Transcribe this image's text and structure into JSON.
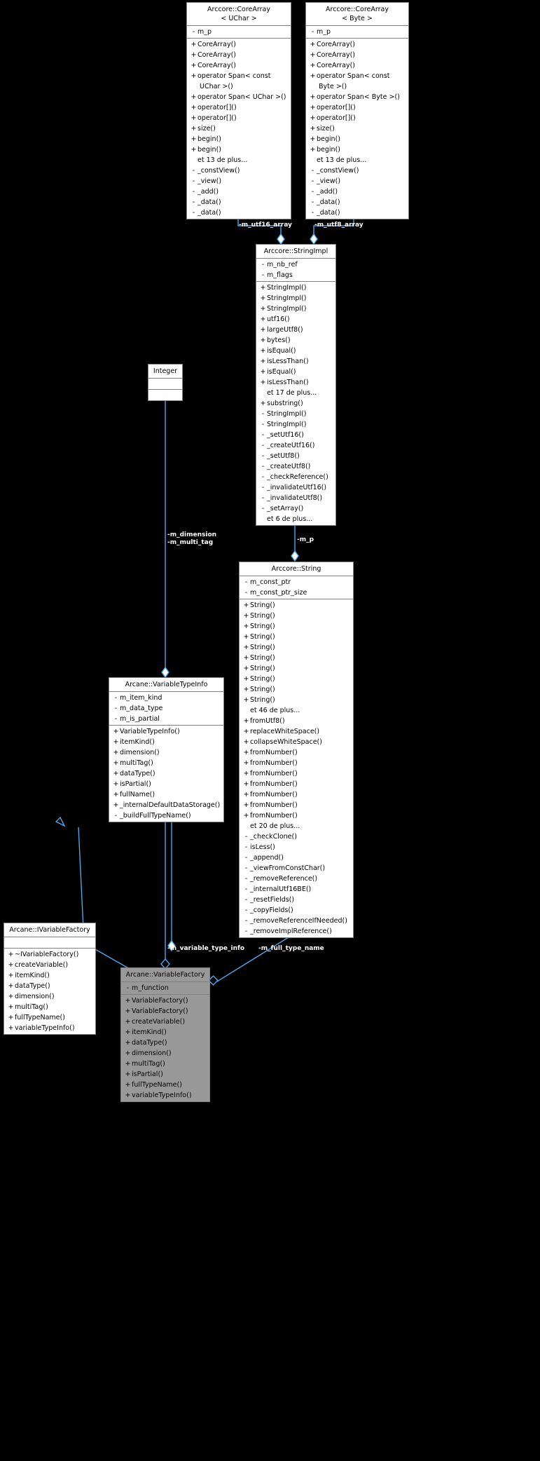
{
  "diagram": {
    "kind": "uml-class-diagram",
    "background": "#000000",
    "edge_color": "#4da6e8",
    "focus_fill": "#999999",
    "box_fill": "#ffffff",
    "more_suffix": "de plus..."
  },
  "classes": {
    "corearray_uchar": {
      "title": "Arccore::CoreArray\n< UChar >",
      "attributes": [
        {
          "vis": "-",
          "name": "m_p"
        }
      ],
      "operations": [
        {
          "vis": "+",
          "name": "CoreArray()"
        },
        {
          "vis": "+",
          "name": "CoreArray()"
        },
        {
          "vis": "+",
          "name": "CoreArray()"
        },
        {
          "vis": "+",
          "name": "operator Span< const\n UChar >()"
        },
        {
          "vis": "+",
          "name": "operator Span< UChar >()"
        },
        {
          "vis": "+",
          "name": "operator[]()"
        },
        {
          "vis": "+",
          "name": "operator[]()"
        },
        {
          "vis": "+",
          "name": "size()"
        },
        {
          "vis": "+",
          "name": "begin()"
        },
        {
          "vis": "+",
          "name": "begin()"
        },
        {
          "vis": "",
          "name": "et 13 de plus..."
        },
        {
          "vis": "-",
          "name": "_constView()"
        },
        {
          "vis": "-",
          "name": "_view()"
        },
        {
          "vis": "-",
          "name": "_add()"
        },
        {
          "vis": "-",
          "name": "_data()"
        },
        {
          "vis": "-",
          "name": "_data()"
        }
      ]
    },
    "corearray_byte": {
      "title": "Arccore::CoreArray\n< Byte >",
      "attributes": [
        {
          "vis": "-",
          "name": "m_p"
        }
      ],
      "operations": [
        {
          "vis": "+",
          "name": "CoreArray()"
        },
        {
          "vis": "+",
          "name": "CoreArray()"
        },
        {
          "vis": "+",
          "name": "CoreArray()"
        },
        {
          "vis": "+",
          "name": "operator Span< const\n Byte >()"
        },
        {
          "vis": "+",
          "name": "operator Span< Byte >()"
        },
        {
          "vis": "+",
          "name": "operator[]()"
        },
        {
          "vis": "+",
          "name": "operator[]()"
        },
        {
          "vis": "+",
          "name": "size()"
        },
        {
          "vis": "+",
          "name": "begin()"
        },
        {
          "vis": "+",
          "name": "begin()"
        },
        {
          "vis": "",
          "name": "et 13 de plus..."
        },
        {
          "vis": "-",
          "name": "_constView()"
        },
        {
          "vis": "-",
          "name": "_view()"
        },
        {
          "vis": "-",
          "name": "_add()"
        },
        {
          "vis": "-",
          "name": "_data()"
        },
        {
          "vis": "-",
          "name": "_data()"
        }
      ]
    },
    "stringimpl": {
      "title": "Arccore::StringImpl",
      "attributes": [
        {
          "vis": "-",
          "name": "m_nb_ref"
        },
        {
          "vis": "-",
          "name": "m_flags"
        }
      ],
      "operations": [
        {
          "vis": "+",
          "name": "StringImpl()"
        },
        {
          "vis": "+",
          "name": "StringImpl()"
        },
        {
          "vis": "+",
          "name": "StringImpl()"
        },
        {
          "vis": "+",
          "name": "utf16()"
        },
        {
          "vis": "+",
          "name": "largeUtf8()"
        },
        {
          "vis": "+",
          "name": "bytes()"
        },
        {
          "vis": "+",
          "name": "isEqual()"
        },
        {
          "vis": "+",
          "name": "isLessThan()"
        },
        {
          "vis": "+",
          "name": "isEqual()"
        },
        {
          "vis": "+",
          "name": "isLessThan()"
        },
        {
          "vis": "",
          "name": "et 17 de plus..."
        },
        {
          "vis": "+",
          "name": "substring()"
        },
        {
          "vis": "-",
          "name": "StringImpl()"
        },
        {
          "vis": "-",
          "name": "StringImpl()"
        },
        {
          "vis": "-",
          "name": "_setUtf16()"
        },
        {
          "vis": "-",
          "name": "_createUtf16()"
        },
        {
          "vis": "-",
          "name": "_setUtf8()"
        },
        {
          "vis": "-",
          "name": "_createUtf8()"
        },
        {
          "vis": "-",
          "name": "_checkReference()"
        },
        {
          "vis": "-",
          "name": "_invalidateUtf16()"
        },
        {
          "vis": "-",
          "name": "_invalidateUtf8()"
        },
        {
          "vis": "-",
          "name": "_setArray()"
        },
        {
          "vis": "",
          "name": "et 6 de plus..."
        }
      ]
    },
    "integer": {
      "title": "Integer",
      "attributes": [],
      "operations": []
    },
    "string": {
      "title": "Arccore::String",
      "attributes": [
        {
          "vis": "-",
          "name": "m_const_ptr"
        },
        {
          "vis": "-",
          "name": "m_const_ptr_size"
        }
      ],
      "operations": [
        {
          "vis": "+",
          "name": "String()"
        },
        {
          "vis": "+",
          "name": "String()"
        },
        {
          "vis": "+",
          "name": "String()"
        },
        {
          "vis": "+",
          "name": "String()"
        },
        {
          "vis": "+",
          "name": "String()"
        },
        {
          "vis": "+",
          "name": "String()"
        },
        {
          "vis": "+",
          "name": "String()"
        },
        {
          "vis": "+",
          "name": "String()"
        },
        {
          "vis": "+",
          "name": "String()"
        },
        {
          "vis": "+",
          "name": "String()"
        },
        {
          "vis": "",
          "name": "et 46 de plus..."
        },
        {
          "vis": "+",
          "name": "fromUtf8()"
        },
        {
          "vis": "+",
          "name": "replaceWhiteSpace()"
        },
        {
          "vis": "+",
          "name": "collapseWhiteSpace()"
        },
        {
          "vis": "+",
          "name": "fromNumber()"
        },
        {
          "vis": "+",
          "name": "fromNumber()"
        },
        {
          "vis": "+",
          "name": "fromNumber()"
        },
        {
          "vis": "+",
          "name": "fromNumber()"
        },
        {
          "vis": "+",
          "name": "fromNumber()"
        },
        {
          "vis": "+",
          "name": "fromNumber()"
        },
        {
          "vis": "+",
          "name": "fromNumber()"
        },
        {
          "vis": "",
          "name": "et 20 de plus..."
        },
        {
          "vis": "-",
          "name": "_checkClone()"
        },
        {
          "vis": "-",
          "name": "isLess()"
        },
        {
          "vis": "-",
          "name": "_append()"
        },
        {
          "vis": "-",
          "name": "_viewFromConstChar()"
        },
        {
          "vis": "-",
          "name": "_removeReference()"
        },
        {
          "vis": "-",
          "name": "_internalUtf16BE()"
        },
        {
          "vis": "-",
          "name": "_resetFields()"
        },
        {
          "vis": "-",
          "name": "_copyFields()"
        },
        {
          "vis": "-",
          "name": "_removeReferenceIfNeeded()"
        },
        {
          "vis": "-",
          "name": "_removeImplReference()"
        }
      ]
    },
    "ivariablefactory": {
      "title": "Arcane::IVariableFactory",
      "attributes": [],
      "operations": [
        {
          "vis": "+",
          "name": "~IVariableFactory()"
        },
        {
          "vis": "+",
          "name": "createVariable()"
        },
        {
          "vis": "+",
          "name": "itemKind()"
        },
        {
          "vis": "+",
          "name": "dataType()"
        },
        {
          "vis": "+",
          "name": "dimension()"
        },
        {
          "vis": "+",
          "name": "multiTag()"
        },
        {
          "vis": "+",
          "name": "fullTypeName()"
        },
        {
          "vis": "+",
          "name": "variableTypeInfo()"
        }
      ]
    },
    "variabletypeinfo": {
      "title": "Arcane::VariableTypeInfo",
      "attributes": [
        {
          "vis": "-",
          "name": "m_item_kind"
        },
        {
          "vis": "-",
          "name": "m_data_type"
        },
        {
          "vis": "-",
          "name": "m_is_partial"
        }
      ],
      "operations": [
        {
          "vis": "+",
          "name": "VariableTypeInfo()"
        },
        {
          "vis": "+",
          "name": "itemKind()"
        },
        {
          "vis": "+",
          "name": "dimension()"
        },
        {
          "vis": "+",
          "name": "multiTag()"
        },
        {
          "vis": "+",
          "name": "dataType()"
        },
        {
          "vis": "+",
          "name": "isPartial()"
        },
        {
          "vis": "+",
          "name": "fullName()"
        },
        {
          "vis": "+",
          "name": "_internalDefaultDataStorage()"
        },
        {
          "vis": "-",
          "name": "_buildFullTypeName()"
        }
      ]
    },
    "variablefactory": {
      "title": "Arcane::VariableFactory",
      "attributes": [
        {
          "vis": "-",
          "name": "m_function"
        }
      ],
      "operations": [
        {
          "vis": "+",
          "name": "VariableFactory()"
        },
        {
          "vis": "+",
          "name": "VariableFactory()"
        },
        {
          "vis": "+",
          "name": "createVariable()"
        },
        {
          "vis": "+",
          "name": "itemKind()"
        },
        {
          "vis": "+",
          "name": "dataType()"
        },
        {
          "vis": "+",
          "name": "dimension()"
        },
        {
          "vis": "+",
          "name": "multiTag()"
        },
        {
          "vis": "+",
          "name": "isPartial()"
        },
        {
          "vis": "+",
          "name": "fullTypeName()"
        },
        {
          "vis": "+",
          "name": "variableTypeInfo()"
        }
      ]
    }
  },
  "edge_labels": {
    "m_utf16_array": "-m_utf16_array",
    "m_utf8_array": "-m_utf8_array",
    "m_p": "-m_p",
    "m_dimension_multi_tag": "-m_dimension\n-m_multi_tag",
    "m_variable_type_info": "-m_variable_type_info",
    "m_full_type_name": "-m_full_type_name"
  }
}
